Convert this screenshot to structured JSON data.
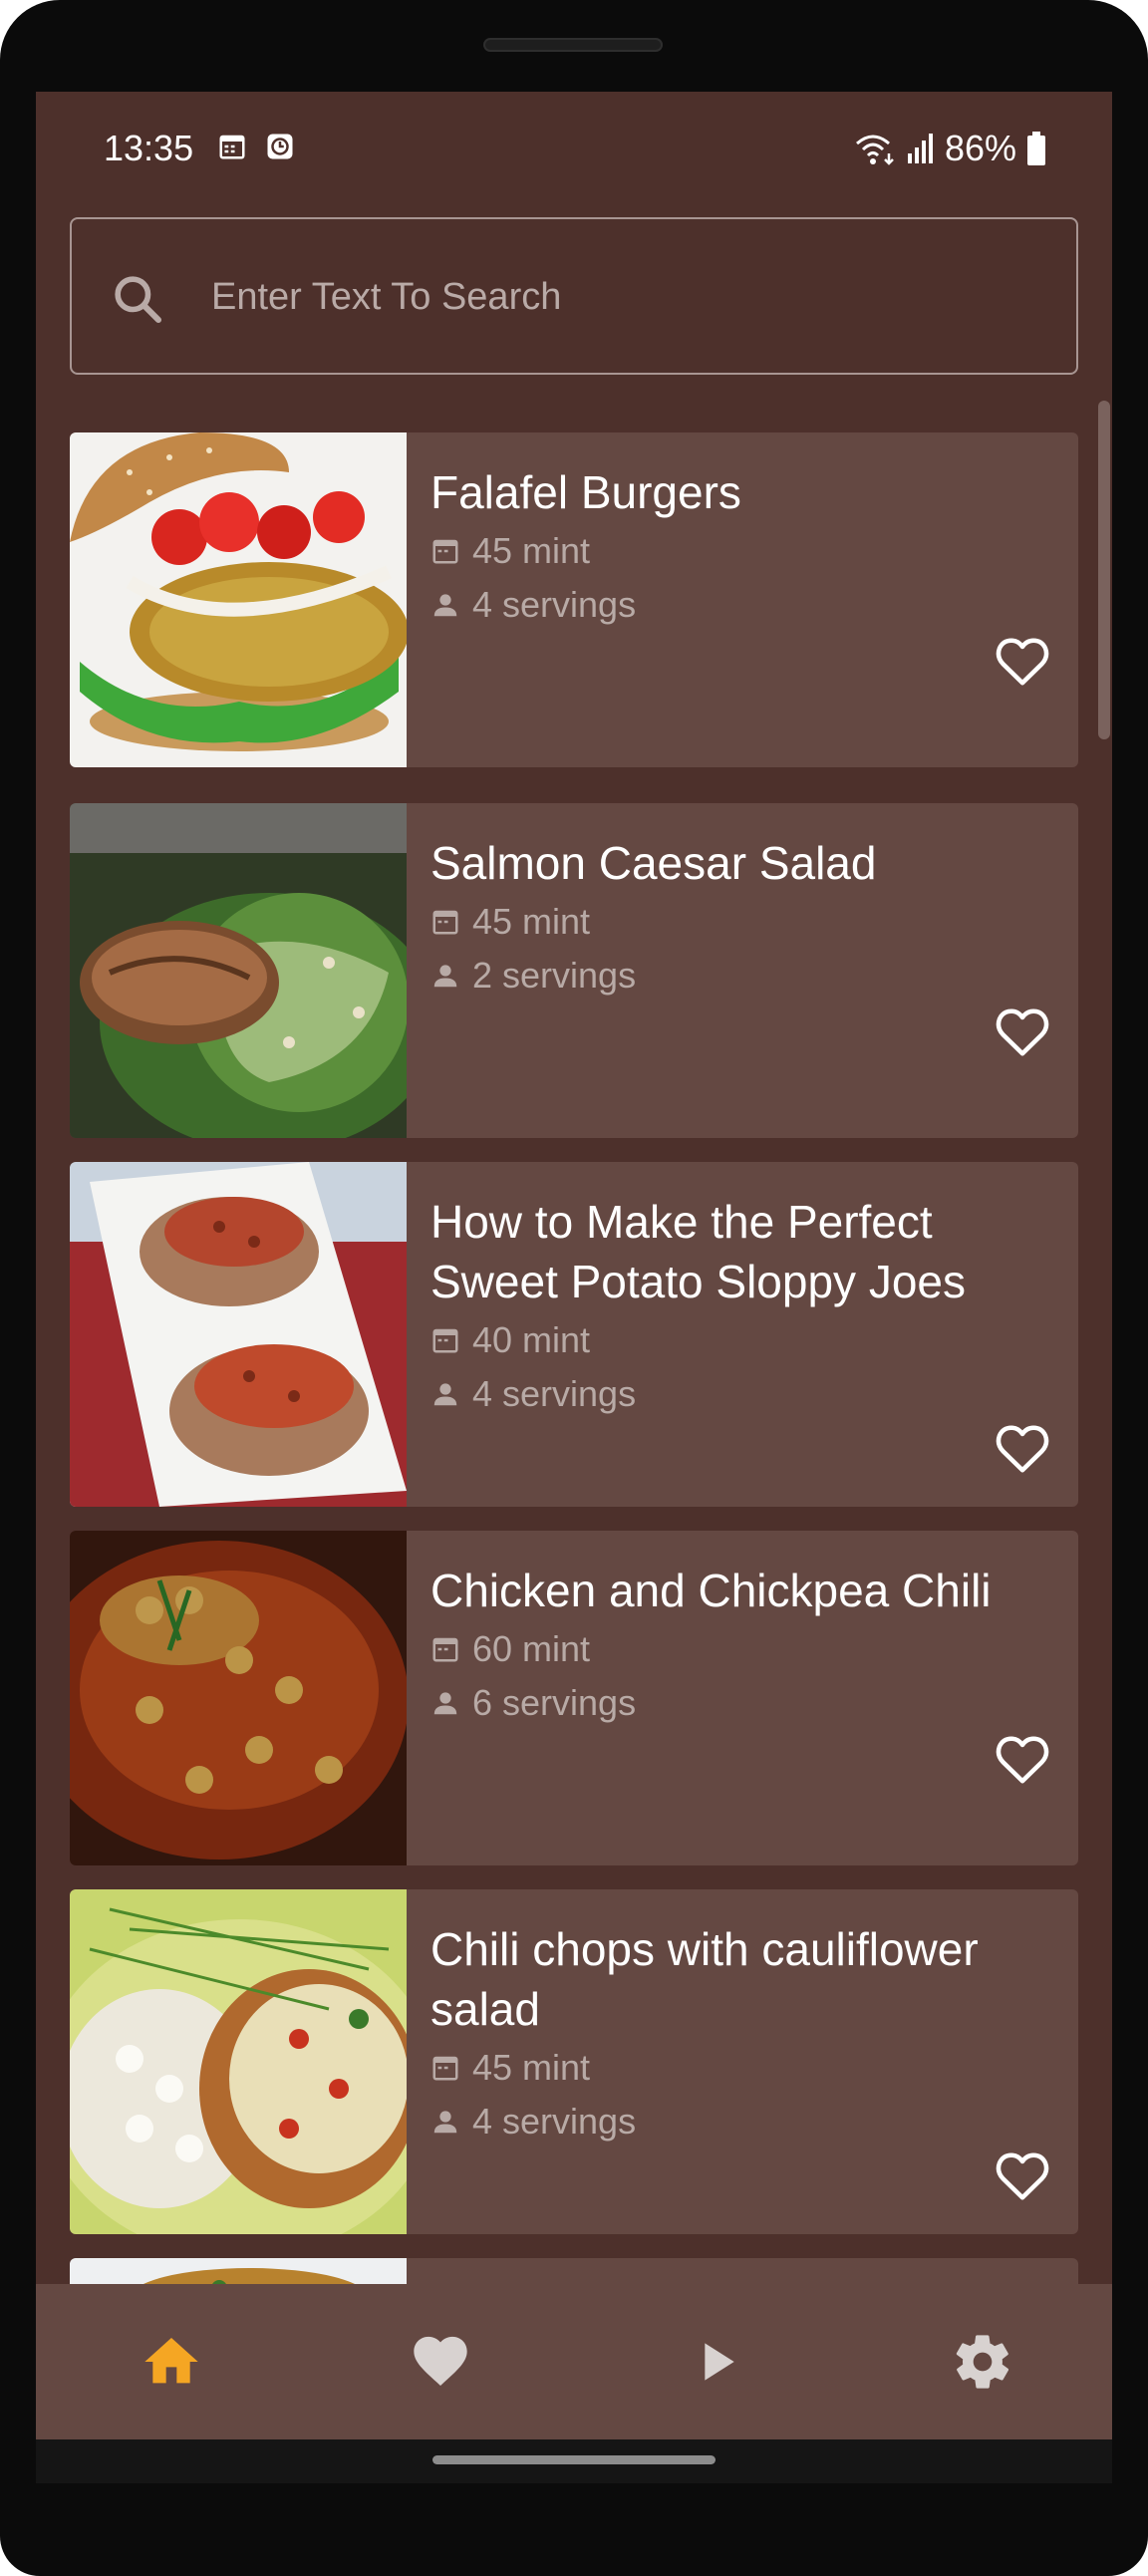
{
  "status_bar": {
    "time": "13:35",
    "battery": "86%",
    "icons": [
      "calendar-icon",
      "clock-app-icon",
      "wifi-icon",
      "signal-icon",
      "battery-icon"
    ]
  },
  "search": {
    "placeholder": "Enter Text To Search",
    "value": "",
    "icon": "search-icon"
  },
  "recipes": [
    {
      "title": "Falafel Burgers",
      "duration": "45 mint",
      "servings": "4 servings",
      "favorite": false
    },
    {
      "title": "Salmon Caesar Salad",
      "duration": "45 mint",
      "servings": "2 servings",
      "favorite": false
    },
    {
      "title": "How to Make the Perfect Sweet Potato Sloppy Joes",
      "duration": "40 mint",
      "servings": "4 servings",
      "favorite": false
    },
    {
      "title": "Chicken and Chickpea Chili",
      "duration": "60 mint",
      "servings": "6 servings",
      "favorite": false
    },
    {
      "title": "Chili chops with cauliflower salad",
      "duration": "45 mint",
      "servings": "4 servings",
      "favorite": false
    }
  ],
  "bottom_nav": {
    "items": [
      {
        "icon": "home-icon",
        "active": true
      },
      {
        "icon": "heart-icon",
        "active": false
      },
      {
        "icon": "play-icon",
        "active": false
      },
      {
        "icon": "settings-icon",
        "active": false
      }
    ]
  },
  "colors": {
    "background": "#4d302b",
    "card": "#644842",
    "accent": "#f5a623",
    "text_primary": "#ffffff",
    "text_secondary": "#b8aaa6"
  }
}
